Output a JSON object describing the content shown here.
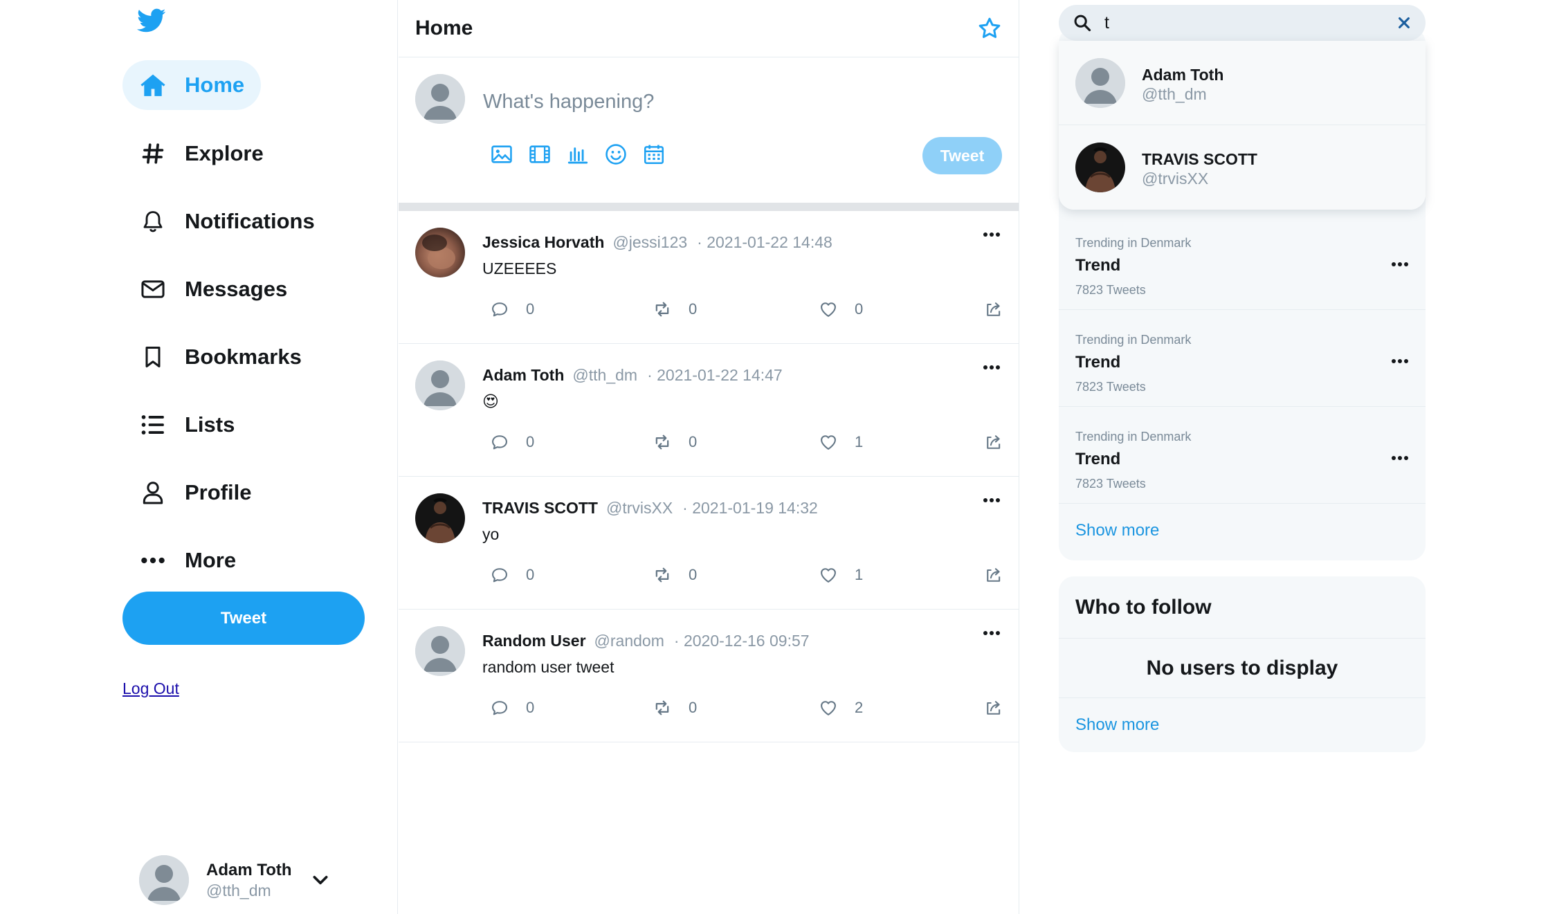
{
  "colors": {
    "accent": "#1da1f2",
    "accent_light": "#e8f5fd",
    "tweet_disabled": "#8fd0f8",
    "muted": "#8a98a5",
    "panel_bg": "#f5f8fa"
  },
  "sidebar": {
    "logo_icon": "twitter-bird-icon",
    "items": [
      {
        "label": "Home",
        "icon": "home-icon",
        "active": true
      },
      {
        "label": "Explore",
        "icon": "hashtag-icon"
      },
      {
        "label": "Notifications",
        "icon": "bell-icon"
      },
      {
        "label": "Messages",
        "icon": "envelope-icon"
      },
      {
        "label": "Bookmarks",
        "icon": "bookmark-icon"
      },
      {
        "label": "Lists",
        "icon": "list-icon"
      },
      {
        "label": "Profile",
        "icon": "person-icon"
      },
      {
        "label": "More",
        "icon": "more-dots-icon"
      }
    ],
    "tweet_button": "Tweet",
    "logout": "Log Out",
    "account": {
      "name": "Adam Toth",
      "handle": "@tth_dm",
      "menu_icon": "chevron-down-icon"
    }
  },
  "main": {
    "title": "Home",
    "header_icon": "star-icon",
    "composer": {
      "placeholder": "What's happening?",
      "tools": [
        "image-icon",
        "film-icon",
        "chart-icon",
        "emoji-icon",
        "calendar-icon"
      ],
      "tweet_button": "Tweet"
    },
    "tweets": [
      {
        "name": "Jessica Horvath",
        "handle": "@jessi123",
        "date": "· 2021-01-22 14:48",
        "text": "UZEEEES",
        "replies": "0",
        "retweets": "0",
        "likes": "0",
        "avatar": "photo-warm"
      },
      {
        "name": "Adam Toth",
        "handle": "@tth_dm",
        "date": "· 2021-01-22 14:47",
        "text": "😍",
        "replies": "0",
        "retweets": "0",
        "likes": "1",
        "avatar": "default"
      },
      {
        "name": "TRAVIS SCOTT",
        "handle": "@trvisXX",
        "date": "· 2021-01-19 14:32",
        "text": "yo",
        "replies": "0",
        "retweets": "0",
        "likes": "1",
        "avatar": "photo-dark"
      },
      {
        "name": "Random User",
        "handle": "@random",
        "date": "· 2020-12-16 09:57",
        "text": "random user tweet",
        "replies": "0",
        "retweets": "0",
        "likes": "2",
        "avatar": "default"
      }
    ]
  },
  "right": {
    "search": {
      "value": "t",
      "icon": "search-icon",
      "clear_icon": "close-icon"
    },
    "search_results": [
      {
        "name": "Adam Toth",
        "handle": "@tth_dm",
        "avatar": "default"
      },
      {
        "name": "TRAVIS SCOTT",
        "handle": "@trvisXX",
        "avatar": "photo-dark"
      }
    ],
    "trends": [
      {
        "location": "Trending in Denmark",
        "name": "Trend",
        "count": "7823 Tweets"
      },
      {
        "location": "Trending in Denmark",
        "name": "Trend",
        "count": "7823 Tweets"
      },
      {
        "location": "Trending in Denmark",
        "name": "Trend",
        "count": "7823 Tweets"
      }
    ],
    "trends_show_more": "Show more",
    "who_to_follow": {
      "title": "Who to follow",
      "empty": "No users to display",
      "show_more": "Show more"
    }
  }
}
